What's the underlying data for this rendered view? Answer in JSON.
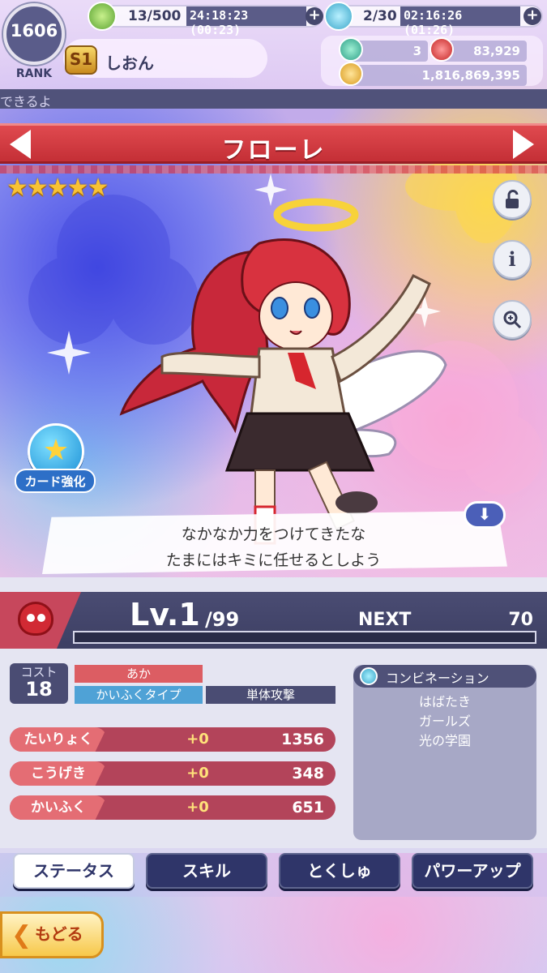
{
  "header": {
    "rank_value": "1606",
    "rank_label": "RANK",
    "stamina": "13/500",
    "stamina_timer": "24:18:23 (00:23)",
    "potion": "2/30",
    "potion_timer": "02:16:26 (01:26)",
    "season_badge": "S1",
    "player_name": "しおん",
    "gems": "3",
    "magic_stones": "83,929",
    "coins": "1,816,869,395",
    "marquee": "できるよ"
  },
  "card": {
    "name": "フローレ",
    "stars": "★★★★★",
    "rarity": 5,
    "enhance_label": "カード強化",
    "dialogue_line1": "なかなか力をつけてきたな",
    "dialogue_line2": "たまにはキミに任せるとしよう"
  },
  "level": {
    "current": "Lv.1",
    "max": "/99",
    "next_label": "NEXT",
    "next_value": "70",
    "progress": 0
  },
  "info": {
    "cost_label": "コスト",
    "cost_value": "18",
    "color": "あか",
    "type": "かいふくタイプ",
    "attack_mode": "単体攻撃"
  },
  "stats": [
    {
      "label": "たいりょく",
      "bonus": "+0",
      "value": "1356"
    },
    {
      "label": "こうげき",
      "bonus": "+0",
      "value": "348"
    },
    {
      "label": "かいふく",
      "bonus": "+0",
      "value": "651"
    }
  ],
  "combination": {
    "title": "コンビネーション",
    "items": [
      "はばたき",
      "ガールズ",
      "光の学園"
    ]
  },
  "tabs": [
    "ステータス",
    "スキル",
    "とくしゅ",
    "パワーアップ"
  ],
  "back_label": "もどる",
  "colors": {
    "banner_red": "#d23c43",
    "panel_navy": "#4a4c73",
    "stat_red": "#b3445a",
    "star_gold": "#f9c233"
  }
}
